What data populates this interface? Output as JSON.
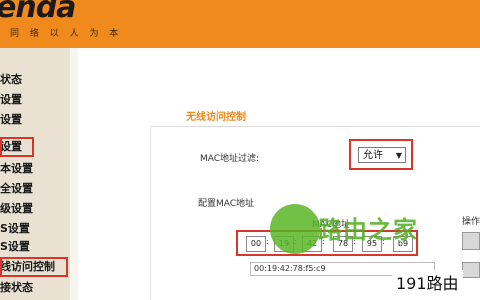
{
  "header": {
    "logo_text": "enda",
    "tagline": "同 络 以 人 为 本"
  },
  "sidebar": {
    "items": [
      {
        "label": "状态"
      },
      {
        "label": "设置"
      },
      {
        "label": "设置"
      },
      {
        "label": "设置"
      },
      {
        "label": "本设置"
      },
      {
        "label": "全设置"
      },
      {
        "label": "级设置"
      },
      {
        "label": "S设置"
      },
      {
        "label": "S设置"
      },
      {
        "label": "线访问控制"
      },
      {
        "label": "接状态"
      }
    ]
  },
  "panel": {
    "title": "无线访问控制",
    "mac_filter_label": "MAC地址过滤:",
    "mac_filter_value": "允许",
    "config_mac_label": "配置MAC地址",
    "mac_header": "MAC地址",
    "ops_header": "操作",
    "mac_inputs": [
      "00",
      "19",
      "42",
      "78",
      "95",
      "b9"
    ],
    "saved_mac": "00:19:42:78:f5:c9"
  },
  "watermark": {
    "text": "路由之家"
  },
  "corner_label": "191路由",
  "colors": {
    "brand_orange": "#f08a1c",
    "highlight_red": "#d9352b",
    "sidebar_bg": "#e9e2d2",
    "watermark_green": "#4fae22"
  }
}
